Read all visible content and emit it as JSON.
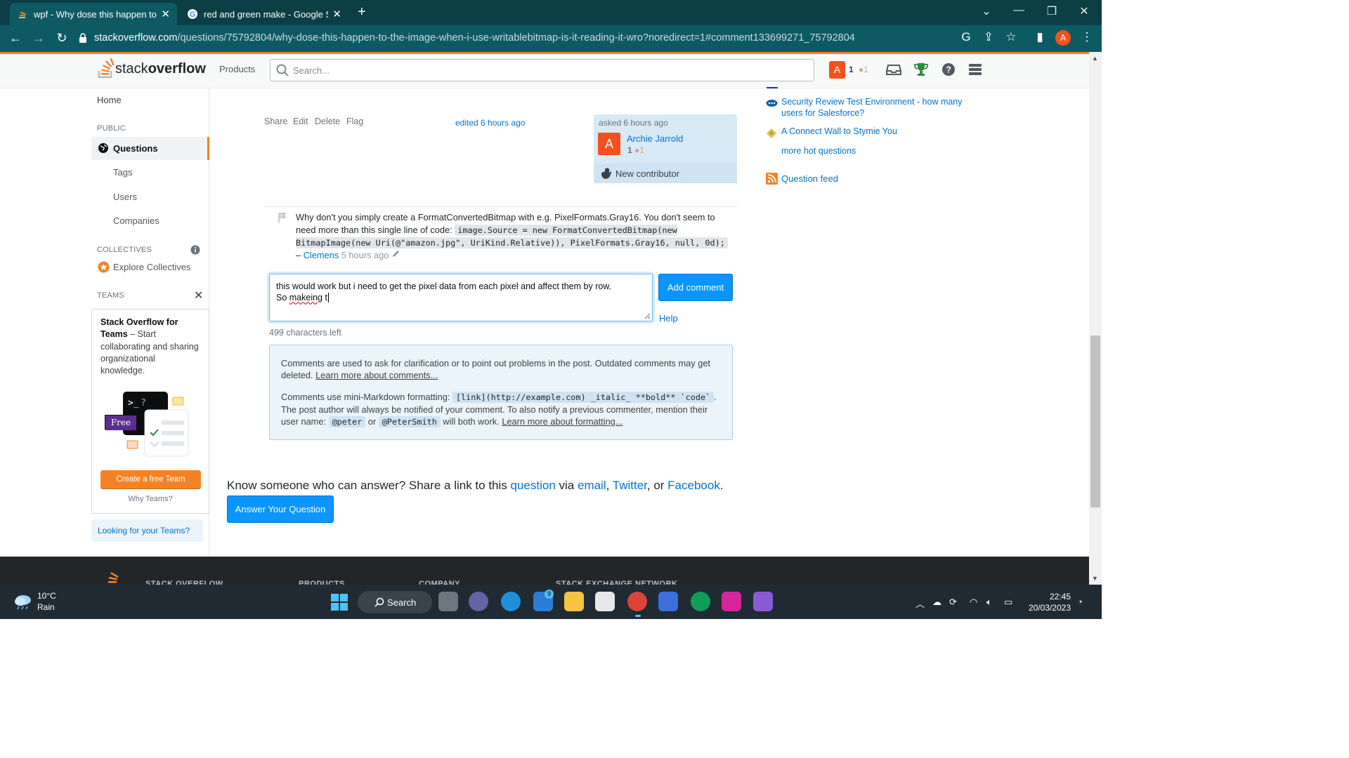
{
  "browser": {
    "tabs": [
      {
        "title": "wpf - Why dose this happen to th"
      },
      {
        "title": "red and green make - Google Se"
      }
    ],
    "url_host": "stackoverflow.com",
    "url_path": "/questions/75792804/why-dose-this-happen-to-the-image-when-i-use-writablebitmap-is-it-reading-it-wro?noredirect=1#comment133699271_75792804",
    "profile_letter": "A"
  },
  "header": {
    "logo_light": "stack",
    "logo_bold": "overflow",
    "products": "Products",
    "search_placeholder": "Search...",
    "user_letter": "A",
    "reputation": "1",
    "bronze": "●1"
  },
  "sidebar": {
    "home": "Home",
    "public": "PUBLIC",
    "questions": "Questions",
    "tags": "Tags",
    "users": "Users",
    "companies": "Companies",
    "collectives": "COLLECTIVES",
    "explore_collectives": "Explore Collectives",
    "teams": "TEAMS",
    "teams_title": "Stack Overflow for Teams",
    "teams_desc": " – Start collaborating and sharing organizational knowledge.",
    "free_badge": "Free",
    "create_team": "Create a free Team",
    "why_teams": "Why Teams?",
    "looking_teams": "Looking for your Teams?"
  },
  "post": {
    "menu": [
      "Share",
      "Edit",
      "Delete",
      "Flag"
    ],
    "edited": "edited 6 hours ago",
    "asked": "asked 6 hours ago",
    "author": "Archie Jarrold",
    "author_letter": "A",
    "author_rep": "1",
    "author_bronze": "●1",
    "new_contributor": "New contributor"
  },
  "comment": {
    "text_before": "Why don't you simply create a FormatConvertedBitmap with e.g. PixelFormats.Gray16. You don't seem to need more than this single line of code: ",
    "code": "image.Source = new FormatConvertedBitmap(new BitmapImage(new Uri(@\"amazon.jpg\", UriKind.Relative)), PixelFormats.Gray16, null, 0d);",
    "dash": " – ",
    "author": "Clemens",
    "time": "5 hours ago"
  },
  "comment_form": {
    "value_line1": "this would work but i need to get the pixel data from each pixel and affect them by row.",
    "value_line2_pre": "So ",
    "value_misspelled": "makeing",
    "value_line2_post": " t",
    "add_button": "Add comment",
    "help": "Help",
    "chars_left": "499 characters left"
  },
  "info": {
    "p1": "Comments are used to ask for clarification or to point out problems in the post. Outdated comments may get deleted. ",
    "p1_link": "Learn more about comments...",
    "p2_a": "Comments use mini-Markdown formatting: ",
    "code_markdown": "[link](http://example.com) _italic_ **bold** `code`",
    "p2_b": ". The post author will always be notified of your comment. To also notify a previous commenter, mention their user name: ",
    "code_peter": "@peter",
    "p2_or": " or ",
    "code_petersmith": "@PeterSmith",
    "p2_c": " will both work. ",
    "p2_link": "Learn more about formatting..."
  },
  "share": {
    "lead": "Know someone who can answer? Share a link to this ",
    "question": "question",
    "via": " via ",
    "email": "email",
    "comma1": ", ",
    "twitter": "Twitter",
    "or": ", or ",
    "facebook": "Facebook",
    "dot": ".",
    "answer_button": "Answer Your Question"
  },
  "right_sidebar": {
    "hot1": "Security Review Test Environment - how many users for Salesforce?",
    "hot2": "A Connect Wall to Stymie You",
    "more": "more hot questions",
    "feed": "Question feed"
  },
  "footer": {
    "cols": [
      "STACK OVERFLOW",
      "PRODUCTS",
      "COMPANY",
      "STACK EXCHANGE NETWORK"
    ]
  },
  "taskbar": {
    "temp": "10°C",
    "condition": "Rain",
    "search": "Search",
    "time": "22:45",
    "date": "20/03/2023",
    "mail_badge": "9"
  }
}
